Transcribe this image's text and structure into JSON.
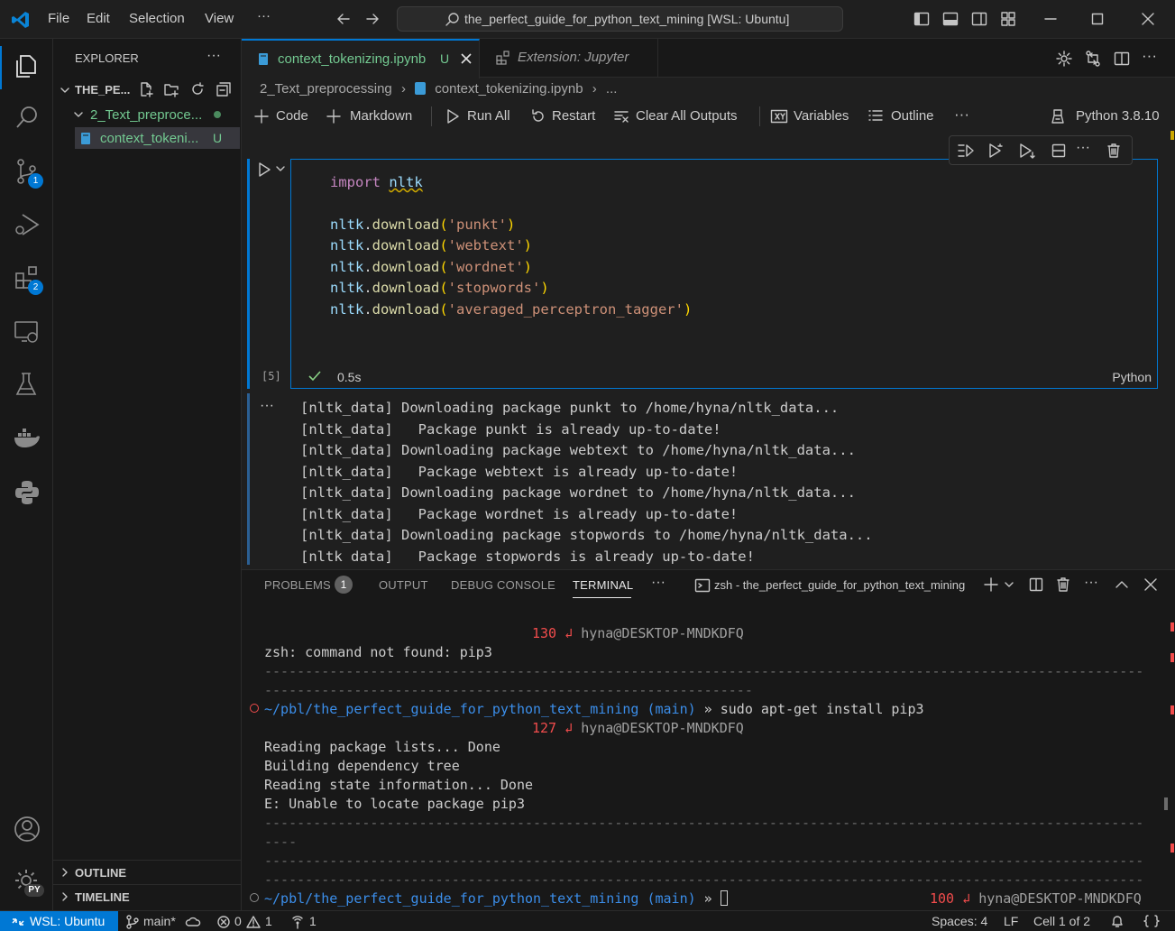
{
  "titlebar": {
    "menus": [
      "File",
      "Edit",
      "Selection",
      "View"
    ],
    "more": "···",
    "command_center": "the_perfect_guide_for_python_text_mining [WSL: Ubuntu]"
  },
  "activity": {
    "source_control_badge": "1",
    "extensions_badge": "2",
    "settings_badge": "PY"
  },
  "sidebar": {
    "title": "EXPLORER",
    "more": "···",
    "root": "THE_PE...",
    "folder": "2_Text_preproce...",
    "file": "context_tokeni...",
    "file_status": "U",
    "outline": "OUTLINE",
    "timeline": "TIMELINE"
  },
  "tabs": {
    "active_label": "context_tokenizing.ipynb",
    "active_status": "U",
    "second_label": "Extension: Jupyter"
  },
  "breadcrumb": {
    "folder": "2_Text_preprocessing",
    "file": "context_tokenizing.ipynb",
    "more": "..."
  },
  "toolbar": {
    "code": "Code",
    "markdown": "Markdown",
    "run_all": "Run All",
    "restart": "Restart",
    "clear_outputs": "Clear All Outputs",
    "variables": "Variables",
    "outline": "Outline",
    "more": "···",
    "kernel": "Python 3.8.10"
  },
  "cell": {
    "execution_count": "[5]",
    "duration": "0.5s",
    "language": "Python",
    "code": {
      "l1_kw": "import",
      "l1_mod": "nltk",
      "downloads": [
        "punkt",
        "webtext",
        "wordnet",
        "stopwords",
        "averaged_perceptron_tagger"
      ],
      "module": "nltk",
      "method": "download"
    },
    "output_more": "···",
    "output": [
      "[nltk_data] Downloading package punkt to /home/hyna/nltk_data...",
      "[nltk_data]   Package punkt is already up-to-date!",
      "[nltk_data] Downloading package webtext to /home/hyna/nltk_data...",
      "[nltk_data]   Package webtext is already up-to-date!",
      "[nltk_data] Downloading package wordnet to /home/hyna/nltk_data...",
      "[nltk_data]   Package wordnet is already up-to-date!",
      "[nltk_data] Downloading package stopwords to /home/hyna/nltk_data...",
      "[nltk_data]   Package stopwords is already up-to-date!"
    ]
  },
  "panel": {
    "tabs": [
      "PROBLEMS",
      "OUTPUT",
      "DEBUG CONSOLE",
      "TERMINAL"
    ],
    "problems_count": "1",
    "more": "···",
    "terminal_name": "zsh - the_perfect_guide_for_python_text_mining",
    "terminal": {
      "rc1": "130",
      "host": "hyna@DESKTOP-MNDKDFQ",
      "err1": "zsh: command not found: pip3",
      "dash_long": "------------------------------------------------------------------------------------------------------------",
      "dash_mid": "------------------------------------------------------------",
      "dash_short": "----",
      "path": "~/pbl/the_perfect_guide_for_python_text_mining",
      "branch": "(main)",
      "arrow": "»",
      "cmd": "sudo apt-get install pip3",
      "rc2": "127",
      "out1": "Reading package lists... Done",
      "out2": "Building dependency tree",
      "out3": "Reading state information... Done",
      "out4": "E: Unable to locate package pip3",
      "rc3": "100",
      "return_glyph": "↲"
    }
  },
  "statusbar": {
    "remote": "WSL: Ubuntu",
    "branch": "main*",
    "errors": "0",
    "warnings": "1",
    "ports": "1",
    "spaces": "Spaces: 4",
    "eol": "LF",
    "cell": "Cell 1 of 2"
  }
}
